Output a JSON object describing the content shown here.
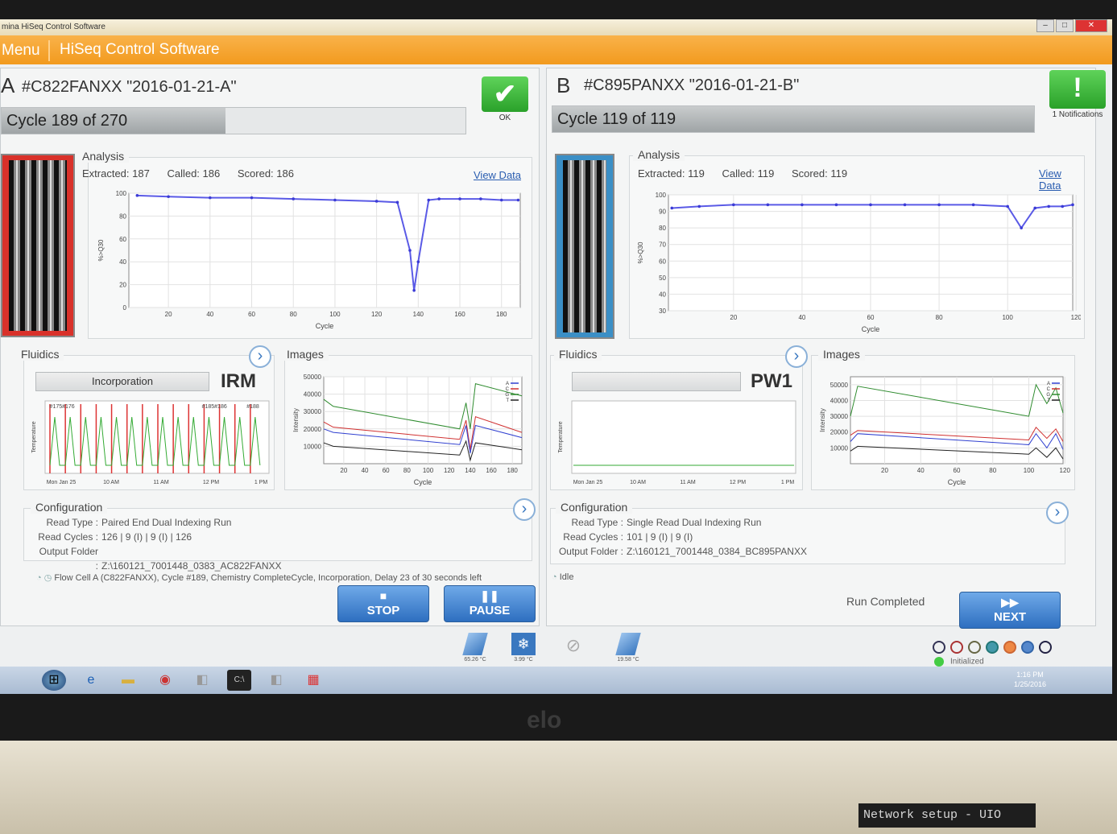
{
  "window": {
    "title": "mina HiSeq Control Software",
    "controls": [
      "–",
      "□",
      "✕"
    ]
  },
  "menubar": {
    "menu_label": "Menu",
    "app_title": "HiSeq Control Software"
  },
  "flowcellA": {
    "letter": "A",
    "title": "#C822FANXX \"2016-01-21-A\"",
    "cycle_text": "Cycle 189 of 270",
    "cycle_current": 189,
    "cycle_total": 270,
    "status_label": "OK",
    "status_icon": "checkmark-icon",
    "analysis": {
      "title": "Analysis",
      "extracted": "Extracted: 187",
      "called": "Called: 186",
      "scored": "Scored: 186",
      "view_data": "View Data"
    },
    "fluidics": {
      "title": "Fluidics",
      "state": "Incorporation",
      "solution": "IRM",
      "marks": [
        "#175#176",
        "#185#186",
        "#188"
      ]
    },
    "images": {
      "title": "Images"
    },
    "configuration": {
      "title": "Configuration",
      "rows": [
        {
          "key": "Read Type :",
          "value": "Paired End Dual Indexing Run"
        },
        {
          "key": "Read Cycles :",
          "value": "126 | 9 (I) | 9 (I) | 126"
        },
        {
          "key": "Output Folder :",
          "value": "Z:\\160121_7001448_0383_AC822FANXX"
        }
      ]
    },
    "status_line": "Flow Cell A (C822FANXX), Cycle #189, Chemistry CompleteCycle, Incorporation, Delay 23 of 30 seconds left",
    "stop_label": "STOP",
    "pause_label": "PAUSE"
  },
  "flowcellB": {
    "letter": "B",
    "title": "#C895PANXX \"2016-01-21-B\"",
    "cycle_text": "Cycle 119 of 119",
    "cycle_current": 119,
    "cycle_total": 119,
    "status_label": "1 Notifications",
    "status_icon": "exclamation-icon",
    "analysis": {
      "title": "Analysis",
      "extracted": "Extracted: 119",
      "called": "Called: 119",
      "scored": "Scored: 119",
      "view_data": "View Data"
    },
    "fluidics": {
      "title": "Fluidics",
      "state": "",
      "solution": "PW1"
    },
    "images": {
      "title": "Images"
    },
    "configuration": {
      "title": "Configuration",
      "rows": [
        {
          "key": "Read Type :",
          "value": "Single Read Dual Indexing Run"
        },
        {
          "key": "Read Cycles :",
          "value": "101 | 9 (I) | 9 (I)"
        },
        {
          "key": "Output Folder :",
          "value": "Z:\\160121_7001448_0384_BC895PANXX"
        }
      ]
    },
    "status_line": "Idle",
    "run_completed": "Run Completed",
    "next_label": "NEXT"
  },
  "bottom": {
    "sensors": [
      "65.26 °C",
      "3.99 °C",
      "",
      "19.58 °C"
    ],
    "initialized": "Initialized"
  },
  "taskbar": {
    "time": "1:16 PM",
    "date": "1/25/2016"
  },
  "bezel": {
    "logo": "elo"
  },
  "terminal": {
    "text": "Network setup - UIO"
  },
  "chart_data": [
    {
      "id": "q30-A",
      "type": "scatter",
      "xlabel": "Cycle",
      "ylabel": "%>Q30",
      "xlim": [
        1,
        189
      ],
      "ylim": [
        0,
        100
      ],
      "xticks": [
        20,
        40,
        60,
        80,
        100,
        120,
        140,
        160,
        180
      ],
      "yticks": [
        0,
        20,
        40,
        60,
        80,
        100
      ],
      "series": [
        {
          "x": [
            5,
            20,
            40,
            60,
            80,
            100,
            120,
            130,
            136,
            138,
            140,
            145,
            150,
            160,
            170,
            180,
            188
          ],
          "y": [
            98,
            97,
            96,
            96,
            95,
            94,
            93,
            92,
            50,
            15,
            40,
            94,
            95,
            95,
            95,
            94,
            94
          ]
        }
      ]
    },
    {
      "id": "q30-B",
      "type": "scatter",
      "xlabel": "Cycle",
      "ylabel": "%>Q30",
      "xlim": [
        1,
        119
      ],
      "ylim": [
        30,
        100
      ],
      "xticks": [
        20,
        40,
        60,
        80,
        100,
        120
      ],
      "yticks": [
        30,
        40,
        50,
        60,
        70,
        80,
        90,
        100
      ],
      "series": [
        {
          "x": [
            2,
            10,
            20,
            30,
            40,
            50,
            60,
            70,
            80,
            90,
            100,
            104,
            108,
            112,
            116,
            119
          ],
          "y": [
            92,
            93,
            94,
            94,
            94,
            94,
            94,
            94,
            94,
            94,
            93,
            80,
            92,
            93,
            93,
            94
          ]
        }
      ]
    },
    {
      "id": "temp-A",
      "type": "line",
      "ylabel": "Temperature",
      "xticks": [
        "Mon Jan 25",
        "10 AM",
        "11 AM",
        "12 PM",
        "1 PM"
      ]
    },
    {
      "id": "temp-B",
      "type": "line",
      "ylabel": "Temperature",
      "xticks": [
        "Mon Jan 25",
        "10 AM",
        "11 AM",
        "12 PM",
        "1 PM"
      ]
    },
    {
      "id": "int-A",
      "type": "line",
      "xlabel": "Cycle",
      "ylabel": "Intensity",
      "xlim": [
        1,
        189
      ],
      "ylim": [
        0,
        50000
      ],
      "xticks": [
        20,
        40,
        60,
        80,
        100,
        120,
        140,
        160,
        180
      ],
      "yticks": [
        10000,
        20000,
        30000,
        40000,
        50000
      ],
      "legend": [
        "A",
        "C",
        "G",
        "T"
      ],
      "series": [
        {
          "name": "G",
          "color": "#2e8b2e",
          "x": [
            1,
            10,
            130,
            136,
            140,
            145,
            189
          ],
          "y": [
            37000,
            33000,
            20000,
            35000,
            20000,
            46000,
            39000
          ]
        },
        {
          "name": "C",
          "color": "#d03030",
          "x": [
            1,
            10,
            130,
            136,
            140,
            145,
            189
          ],
          "y": [
            24000,
            21000,
            14000,
            25000,
            8000,
            27000,
            18000
          ]
        },
        {
          "name": "A",
          "color": "#3040d0",
          "x": [
            1,
            10,
            130,
            136,
            140,
            145,
            189
          ],
          "y": [
            20000,
            18000,
            11000,
            22000,
            6000,
            22000,
            15000
          ]
        },
        {
          "name": "T",
          "color": "#222222",
          "x": [
            1,
            10,
            130,
            136,
            140,
            145,
            189
          ],
          "y": [
            12000,
            10000,
            5000,
            13000,
            2000,
            12000,
            8000
          ]
        }
      ]
    },
    {
      "id": "int-B",
      "type": "line",
      "xlabel": "Cycle",
      "ylabel": "Intensity",
      "xlim": [
        1,
        119
      ],
      "ylim": [
        0,
        55000
      ],
      "xticks": [
        20,
        40,
        60,
        80,
        100,
        120
      ],
      "yticks": [
        10000,
        20000,
        30000,
        40000,
        50000
      ],
      "legend": [
        "A",
        "C",
        "G",
        "T"
      ],
      "series": [
        {
          "name": "G",
          "color": "#2e8b2e",
          "x": [
            1,
            5,
            100,
            104,
            110,
            115,
            119
          ],
          "y": [
            30000,
            49000,
            30000,
            50000,
            38000,
            48000,
            32000
          ]
        },
        {
          "name": "C",
          "color": "#d03030",
          "x": [
            1,
            5,
            100,
            104,
            110,
            115,
            119
          ],
          "y": [
            18000,
            21000,
            15000,
            23000,
            16000,
            22000,
            14000
          ]
        },
        {
          "name": "A",
          "color": "#3040d0",
          "x": [
            1,
            5,
            100,
            104,
            110,
            115,
            119
          ],
          "y": [
            14000,
            19000,
            12000,
            19000,
            10000,
            19000,
            9000
          ]
        },
        {
          "name": "T",
          "color": "#222222",
          "x": [
            1,
            5,
            100,
            104,
            110,
            115,
            119
          ],
          "y": [
            8000,
            11000,
            6000,
            10000,
            4000,
            10000,
            3000
          ]
        }
      ]
    }
  ]
}
